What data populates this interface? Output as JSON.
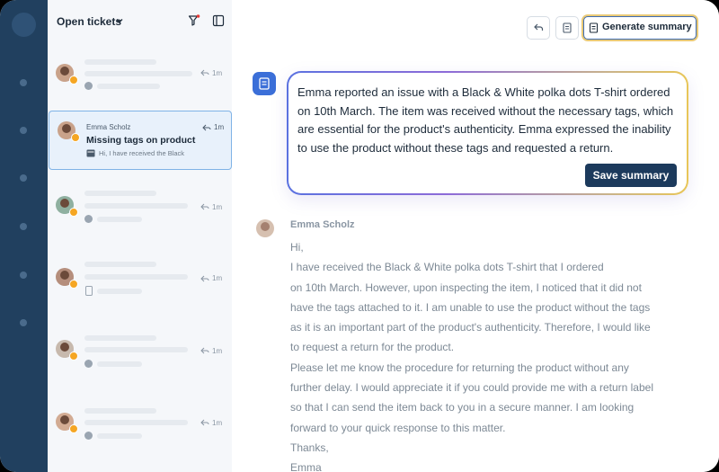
{
  "sidebar": {
    "list_title": "Open tickets"
  },
  "tickets": [
    {
      "time": "1m",
      "channel": "facebook-icon"
    },
    {
      "name": "Emma Scholz",
      "subject": "Missing tags on product",
      "preview": "Hi, I have received the Black",
      "channel": "email-icon",
      "selected": true
    },
    {
      "time": "1m",
      "channel": "chat-icon"
    },
    {
      "time": "1m",
      "channel": "mobile-icon"
    },
    {
      "time": "1m",
      "channel": "web-icon"
    },
    {
      "time": "1m",
      "channel": "facebook-icon"
    }
  ],
  "toolbar": {
    "generate_label": "Generate summary"
  },
  "summary": {
    "text": "Emma reported an issue with a Black & White polka dots T-shirt ordered on 10th March. The item was received without the necessary tags, which are essential for the product's authenticity. Emma expressed the inability to use the product without these tags and requested a return.",
    "save_label": "Save summary"
  },
  "message": {
    "author": "Emma Scholz",
    "lines": [
      "Hi,",
      "I have received the Black & White polka dots T-shirt that I ordered",
      "on 10th March. However, upon inspecting the item, I noticed that it did not",
      "have the tags attached to it. I am unable to use the product without the tags",
      "as it is an important part of the product's authenticity. Therefore, I would like",
      "to request a return for the product.",
      "Please let me know the procedure for returning the product without any",
      "further delay. I would appreciate it if you could provide me with a return label",
      "so that I can send the item back to you in a secure manner. I am looking",
      "forward to your quick response to this matter.",
      "Thanks,",
      "Emma"
    ]
  },
  "colors": {
    "rail": "#21405f",
    "accent": "#3b6fd8",
    "primary_button": "#1c3a5c"
  }
}
